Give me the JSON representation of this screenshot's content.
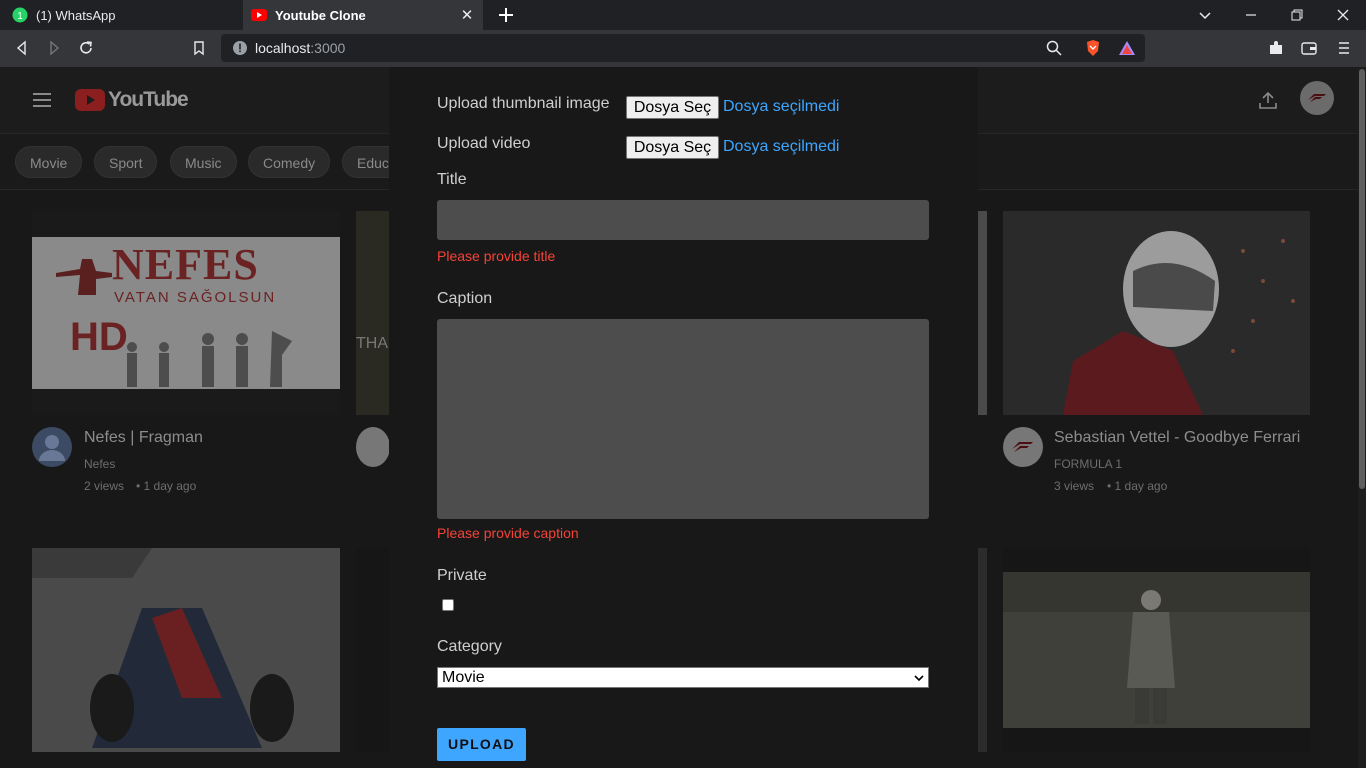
{
  "browser": {
    "tabs": [
      {
        "title": "(1) WhatsApp",
        "active": false,
        "favicon": "whatsapp-icon"
      },
      {
        "title": "Youtube Clone",
        "active": true,
        "favicon": "youtube-icon"
      }
    ],
    "url_host": "localhost",
    "url_port": ":3000"
  },
  "youtube": {
    "logo_text": "YouTube",
    "chips": [
      "Movie",
      "Sport",
      "Music",
      "Comedy",
      "Educ"
    ],
    "videos": [
      {
        "title": "Nefes | Fragman",
        "channel": "Nefes",
        "views": "2 views",
        "age": "• 1 day ago",
        "thumb_text_1": "NEFES",
        "thumb_text_2": "VATAN SAĞOLSUN",
        "thumb_text_3": "HD"
      },
      {
        "title": "Sebastian Vettel - Goodbye Ferrari",
        "channel": "FORMULA 1",
        "views": "3 views",
        "age": "• 1 day ago"
      }
    ],
    "partial_thumb_text": "THAD"
  },
  "modal": {
    "thumbnail_label": "Upload thumbnail image",
    "video_label": "Upload video",
    "file_button_label": "Dosya Seç",
    "file_status": "Dosya seçilmedi",
    "title_label": "Title",
    "title_value": "",
    "title_error": "Please provide title",
    "caption_label": "Caption",
    "caption_value": "",
    "caption_error": "Please provide caption",
    "private_label": "Private",
    "private_checked": false,
    "category_label": "Category",
    "category_selected": "Movie",
    "upload_label": "UPLOAD"
  },
  "colors": {
    "accent": "#3ea6ff",
    "error": "#f44336",
    "youtube_red": "#ff0000"
  }
}
